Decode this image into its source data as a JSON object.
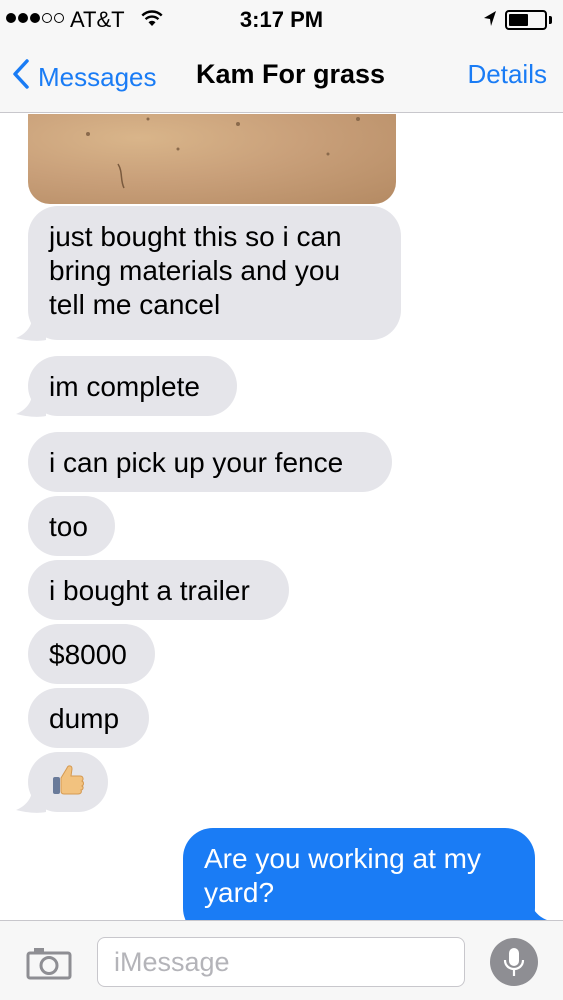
{
  "status_bar": {
    "carrier": "AT&T",
    "time": "3:17 PM",
    "signal_bars_filled": 3,
    "signal_bars_total": 5,
    "battery_level": 0.55
  },
  "nav": {
    "back_label": "Messages",
    "title": "Kam For grass",
    "details_label": "Details"
  },
  "messages": [
    {
      "sender": "them",
      "type": "image"
    },
    {
      "sender": "them",
      "text": "just bought this so i can bring materials and you tell me cancel",
      "lines": [
        "just bought this so i can",
        "bring materials and you",
        "tell me cancel"
      ]
    },
    {
      "sender": "them",
      "text": "im complete"
    },
    {
      "sender": "them",
      "text": "i can pick up your fence"
    },
    {
      "sender": "them",
      "text": "too"
    },
    {
      "sender": "them",
      "text": "i bought a trailer"
    },
    {
      "sender": "them",
      "text": "$8000"
    },
    {
      "sender": "them",
      "text": "dump"
    },
    {
      "sender": "them",
      "text": "👍"
    },
    {
      "sender": "me",
      "text": "Are you working at my yard?",
      "lines": [
        "Are you working at my",
        "yard?"
      ]
    }
  ],
  "input": {
    "placeholder": "iMessage",
    "value": ""
  },
  "colors": {
    "accent": "#1a7cf5",
    "received_bubble": "#e5e5ea",
    "sent_bubble": "#1a7cf5",
    "bar_background": "#f7f7f7"
  },
  "icons": {
    "back": "chevron-left-icon",
    "camera": "camera-icon",
    "mic": "microphone-icon",
    "wifi": "wifi-icon",
    "location": "location-arrow-icon",
    "battery": "battery-icon"
  }
}
